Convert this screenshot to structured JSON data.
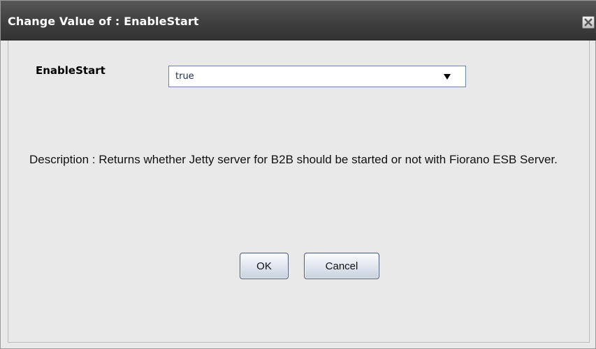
{
  "dialog": {
    "title": "Change Value of : EnableStart",
    "close_icon": "close-icon"
  },
  "form": {
    "field_label": "EnableStart",
    "select_value": "true",
    "select_icon": "chevron-down-icon"
  },
  "description": "Description : Returns whether Jetty server for B2B should be started or not with Fiorano ESB Server.",
  "buttons": {
    "ok_label": "OK",
    "cancel_label": "Cancel"
  },
  "colors": {
    "titlebar": "#3f3f3f",
    "title_text": "#ffffff",
    "dialog_bg": "#e9e9e9",
    "select_border": "#6f86a8",
    "button_border": "#4d5d78"
  }
}
